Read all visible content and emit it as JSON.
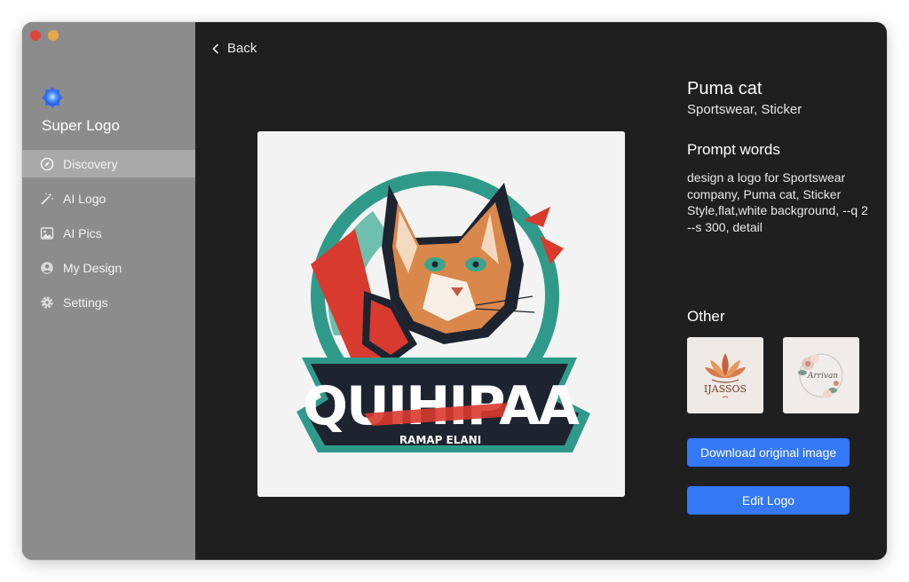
{
  "app": {
    "name": "Super Logo"
  },
  "window": {
    "controls": [
      "close",
      "minimize"
    ]
  },
  "sidebar": {
    "items": [
      {
        "label": "Discovery",
        "icon": "compass-icon",
        "active": true
      },
      {
        "label": "AI Logo",
        "icon": "magic-wand-icon",
        "active": false
      },
      {
        "label": "AI Pics",
        "icon": "image-icon",
        "active": false
      },
      {
        "label": "My Design",
        "icon": "user-icon",
        "active": false
      },
      {
        "label": "Settings",
        "icon": "gear-icon",
        "active": false
      }
    ]
  },
  "main": {
    "back_label": "Back",
    "image": {
      "wordmark": "QUIHIPAA",
      "tagline": "RAMAP ELANI"
    },
    "detail": {
      "title": "Puma cat",
      "subtitle": "Sportswear, Sticker",
      "prompt_heading": "Prompt words",
      "prompt_text": "design a logo for Sportswear company, Puma cat, Sticker Style,flat,white background, --q 2 --s 300, detail",
      "other_heading": "Other",
      "others": [
        {
          "text": "IJASSOS"
        },
        {
          "text": "Arrivan"
        }
      ]
    },
    "buttons": {
      "download": "Download original image",
      "edit": "Edit Logo"
    }
  },
  "colors": {
    "accent": "#3478f6",
    "sidebar_bg": "#8c8c8c",
    "sidebar_active": "#a9a9a9",
    "content_bg": "#1f1f1f"
  }
}
